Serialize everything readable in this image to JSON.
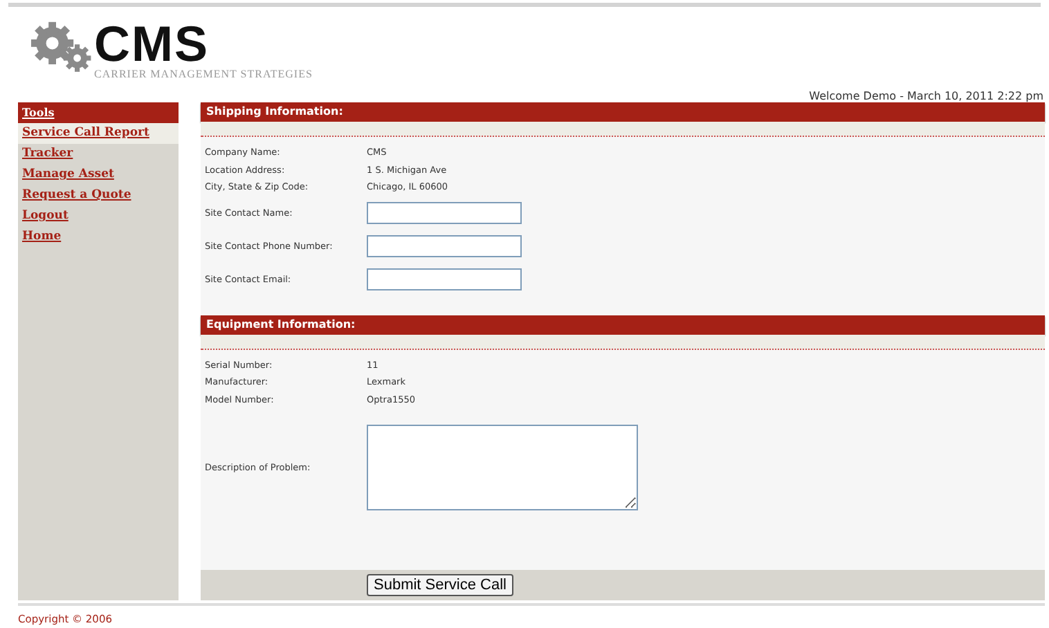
{
  "logo": {
    "name": "CMS",
    "tagline": "CARRIER MANAGEMENT STRATEGIES"
  },
  "welcome": "Welcome Demo - March 10, 2011 2:22 pm",
  "sidebar": {
    "title": "Tools",
    "items": [
      {
        "label": "Service Call Report"
      },
      {
        "label": "Tracker"
      },
      {
        "label": "Manage Asset"
      },
      {
        "label": "Request a Quote"
      },
      {
        "label": "Logout"
      },
      {
        "label": "Home"
      }
    ]
  },
  "sections": [
    {
      "title": "Shipping Information:",
      "rows": [
        {
          "kind": "text",
          "label": "Company Name:",
          "value": "CMS"
        },
        {
          "kind": "text",
          "label": "Location Address:",
          "value": "1 S. Michigan Ave"
        },
        {
          "kind": "text",
          "label": "City, State & Zip Code:",
          "value": "Chicago, IL 60600"
        },
        {
          "kind": "input",
          "label": "Site Contact Name:"
        },
        {
          "kind": "input",
          "label": "Site Contact Phone Number:"
        },
        {
          "kind": "input",
          "label": "Site Contact Email:"
        }
      ]
    },
    {
      "title": "Equipment Information:",
      "rows": [
        {
          "kind": "text",
          "label": "Serial Number:",
          "value": "11"
        },
        {
          "kind": "text",
          "label": "Manufacturer:",
          "value": "Lexmark"
        },
        {
          "kind": "text",
          "label": "Model Number:",
          "value": "Optra1550"
        },
        {
          "kind": "textarea",
          "label": "Description of Problem:"
        }
      ]
    }
  ],
  "submit": "Submit Service Call",
  "copyright": "Copyright © 2006"
}
